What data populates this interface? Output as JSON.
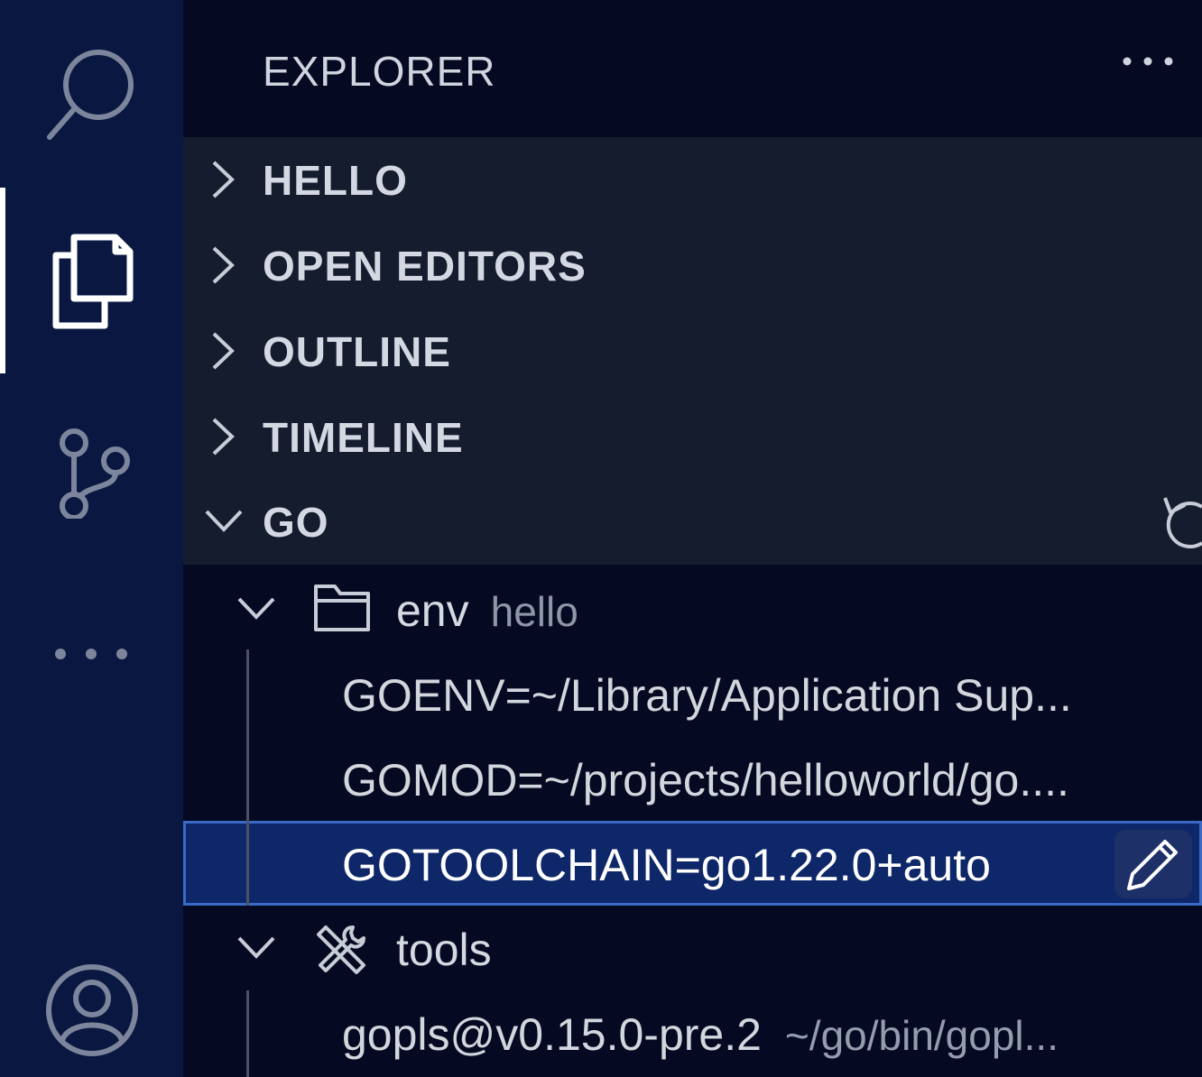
{
  "activity_bar": {
    "items": [
      {
        "name": "search",
        "icon": "search-icon"
      },
      {
        "name": "explorer",
        "icon": "files-icon",
        "active": true
      },
      {
        "name": "source-control",
        "icon": "source-control-icon"
      },
      {
        "name": "more",
        "icon": "more-icon"
      },
      {
        "name": "accounts",
        "icon": "account-icon"
      }
    ]
  },
  "sidebar": {
    "title": "EXPLORER",
    "sections": [
      {
        "label": "HELLO",
        "expanded": false
      },
      {
        "label": "OPEN EDITORS",
        "expanded": false
      },
      {
        "label": "OUTLINE",
        "expanded": false
      },
      {
        "label": "TIMELINE",
        "expanded": false
      },
      {
        "label": "GO",
        "expanded": true
      }
    ],
    "go_tree": {
      "env": {
        "label": "env",
        "description": "hello",
        "icon": "folder-icon",
        "items": [
          "GOENV=~/Library/Application Sup...",
          "GOMOD=~/projects/helloworld/go....",
          "GOTOOLCHAIN=go1.22.0+auto"
        ]
      },
      "tools": {
        "label": "tools",
        "icon": "tools-icon",
        "items": [
          {
            "label": "gopls@v0.15.0-pre.2",
            "description": "~/go/bin/gopl..."
          }
        ]
      }
    }
  },
  "colors": {
    "activity_bar_bg": "#0a1841",
    "sidebar_bg": "#050a22",
    "section_bg": "#151c2e",
    "selection_bg": "#0e2768",
    "selection_border": "#3b69c6"
  }
}
